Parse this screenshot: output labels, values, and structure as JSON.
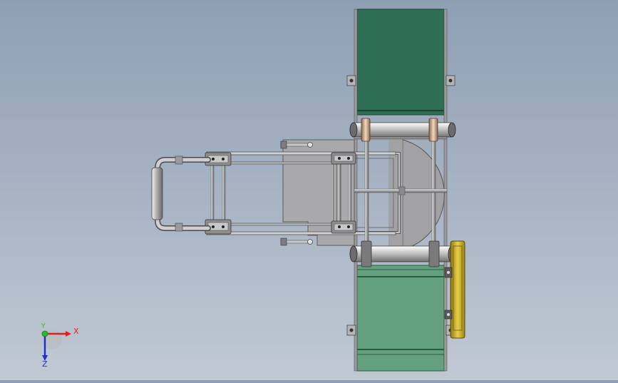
{
  "view": {
    "background_top": "#8f9fb3",
    "background_bottom": "#c0c9d3"
  },
  "colors": {
    "conveyor_top": "#2f6e56",
    "conveyor_bottom": "#62a07e",
    "frame_steel": "#a9a9ac",
    "motor_yellow": "#c9b032",
    "axis_x": "#e02020",
    "axis_y": "#2fb52f",
    "axis_z": "#2030d0"
  },
  "triad": {
    "x_label": "X",
    "y_label": "Y",
    "z_label": "Z",
    "x_icon": "x-axis-arrow-icon",
    "y_icon": "y-axis-dot-icon",
    "z_icon": "z-axis-arrow-icon"
  }
}
